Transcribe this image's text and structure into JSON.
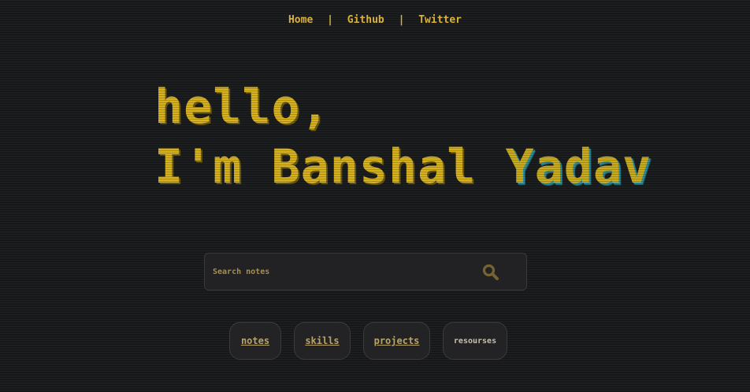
{
  "nav": {
    "home": "Home",
    "separator": "|",
    "github": "Github",
    "twitter": "Twitter"
  },
  "hero": {
    "line1": "hello,",
    "line2_prefix": "I'm Banshal ",
    "line2_accent": "Yadav"
  },
  "search": {
    "placeholder": "Search notes",
    "icon": "search-icon"
  },
  "links": {
    "notes": "notes",
    "skills": "skills",
    "projects": "projects",
    "resources": "resourses"
  },
  "colors": {
    "background": "#1a1b1d",
    "accent": "#d7b11e",
    "accent_shadow": "#2f8f9a",
    "pill_background": "#232325"
  }
}
